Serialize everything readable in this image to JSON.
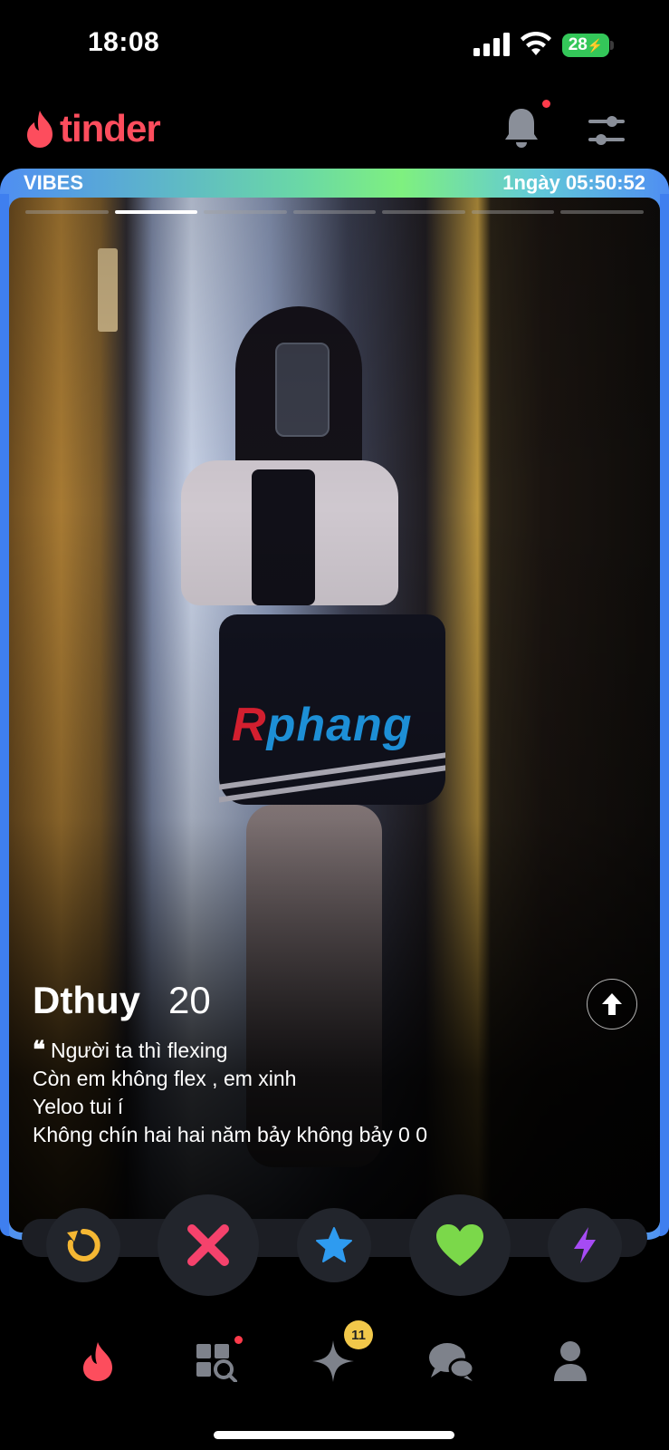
{
  "status_bar": {
    "time": "18:08",
    "battery": "28"
  },
  "header": {
    "logo_text": "tinder"
  },
  "card": {
    "badge_label": "VIBES",
    "countdown": "1ngày 05:50:52",
    "photo_count": 7,
    "active_photo_index": 1,
    "watermark_first": "R",
    "watermark_rest": "phang",
    "name": "Dthuy",
    "age": "20",
    "bio": [
      "Người ta thì flexing",
      "Còn em không flex , em xinh",
      "Yeloo tui í",
      "Không chín hai hai năm bảy không bảy 0 0"
    ]
  },
  "actions": [
    "rewind-icon",
    "nope-icon",
    "super-like-icon",
    "like-icon",
    "boost-icon"
  ],
  "tabs": {
    "items": [
      "home-flame-icon",
      "explore-icon",
      "gold-sparkle-icon",
      "chat-icon",
      "profile-icon"
    ],
    "gold_badge": "11"
  },
  "colors": {
    "brand": "#fd4d5d",
    "frame_blue": "#3f7fef",
    "frame_green": "#7ff07f",
    "nope": "#f5426c",
    "super_like": "#2e9bf0",
    "like": "#7bd84a",
    "boost": "#a64bf4",
    "rewind": "#f5b733"
  }
}
